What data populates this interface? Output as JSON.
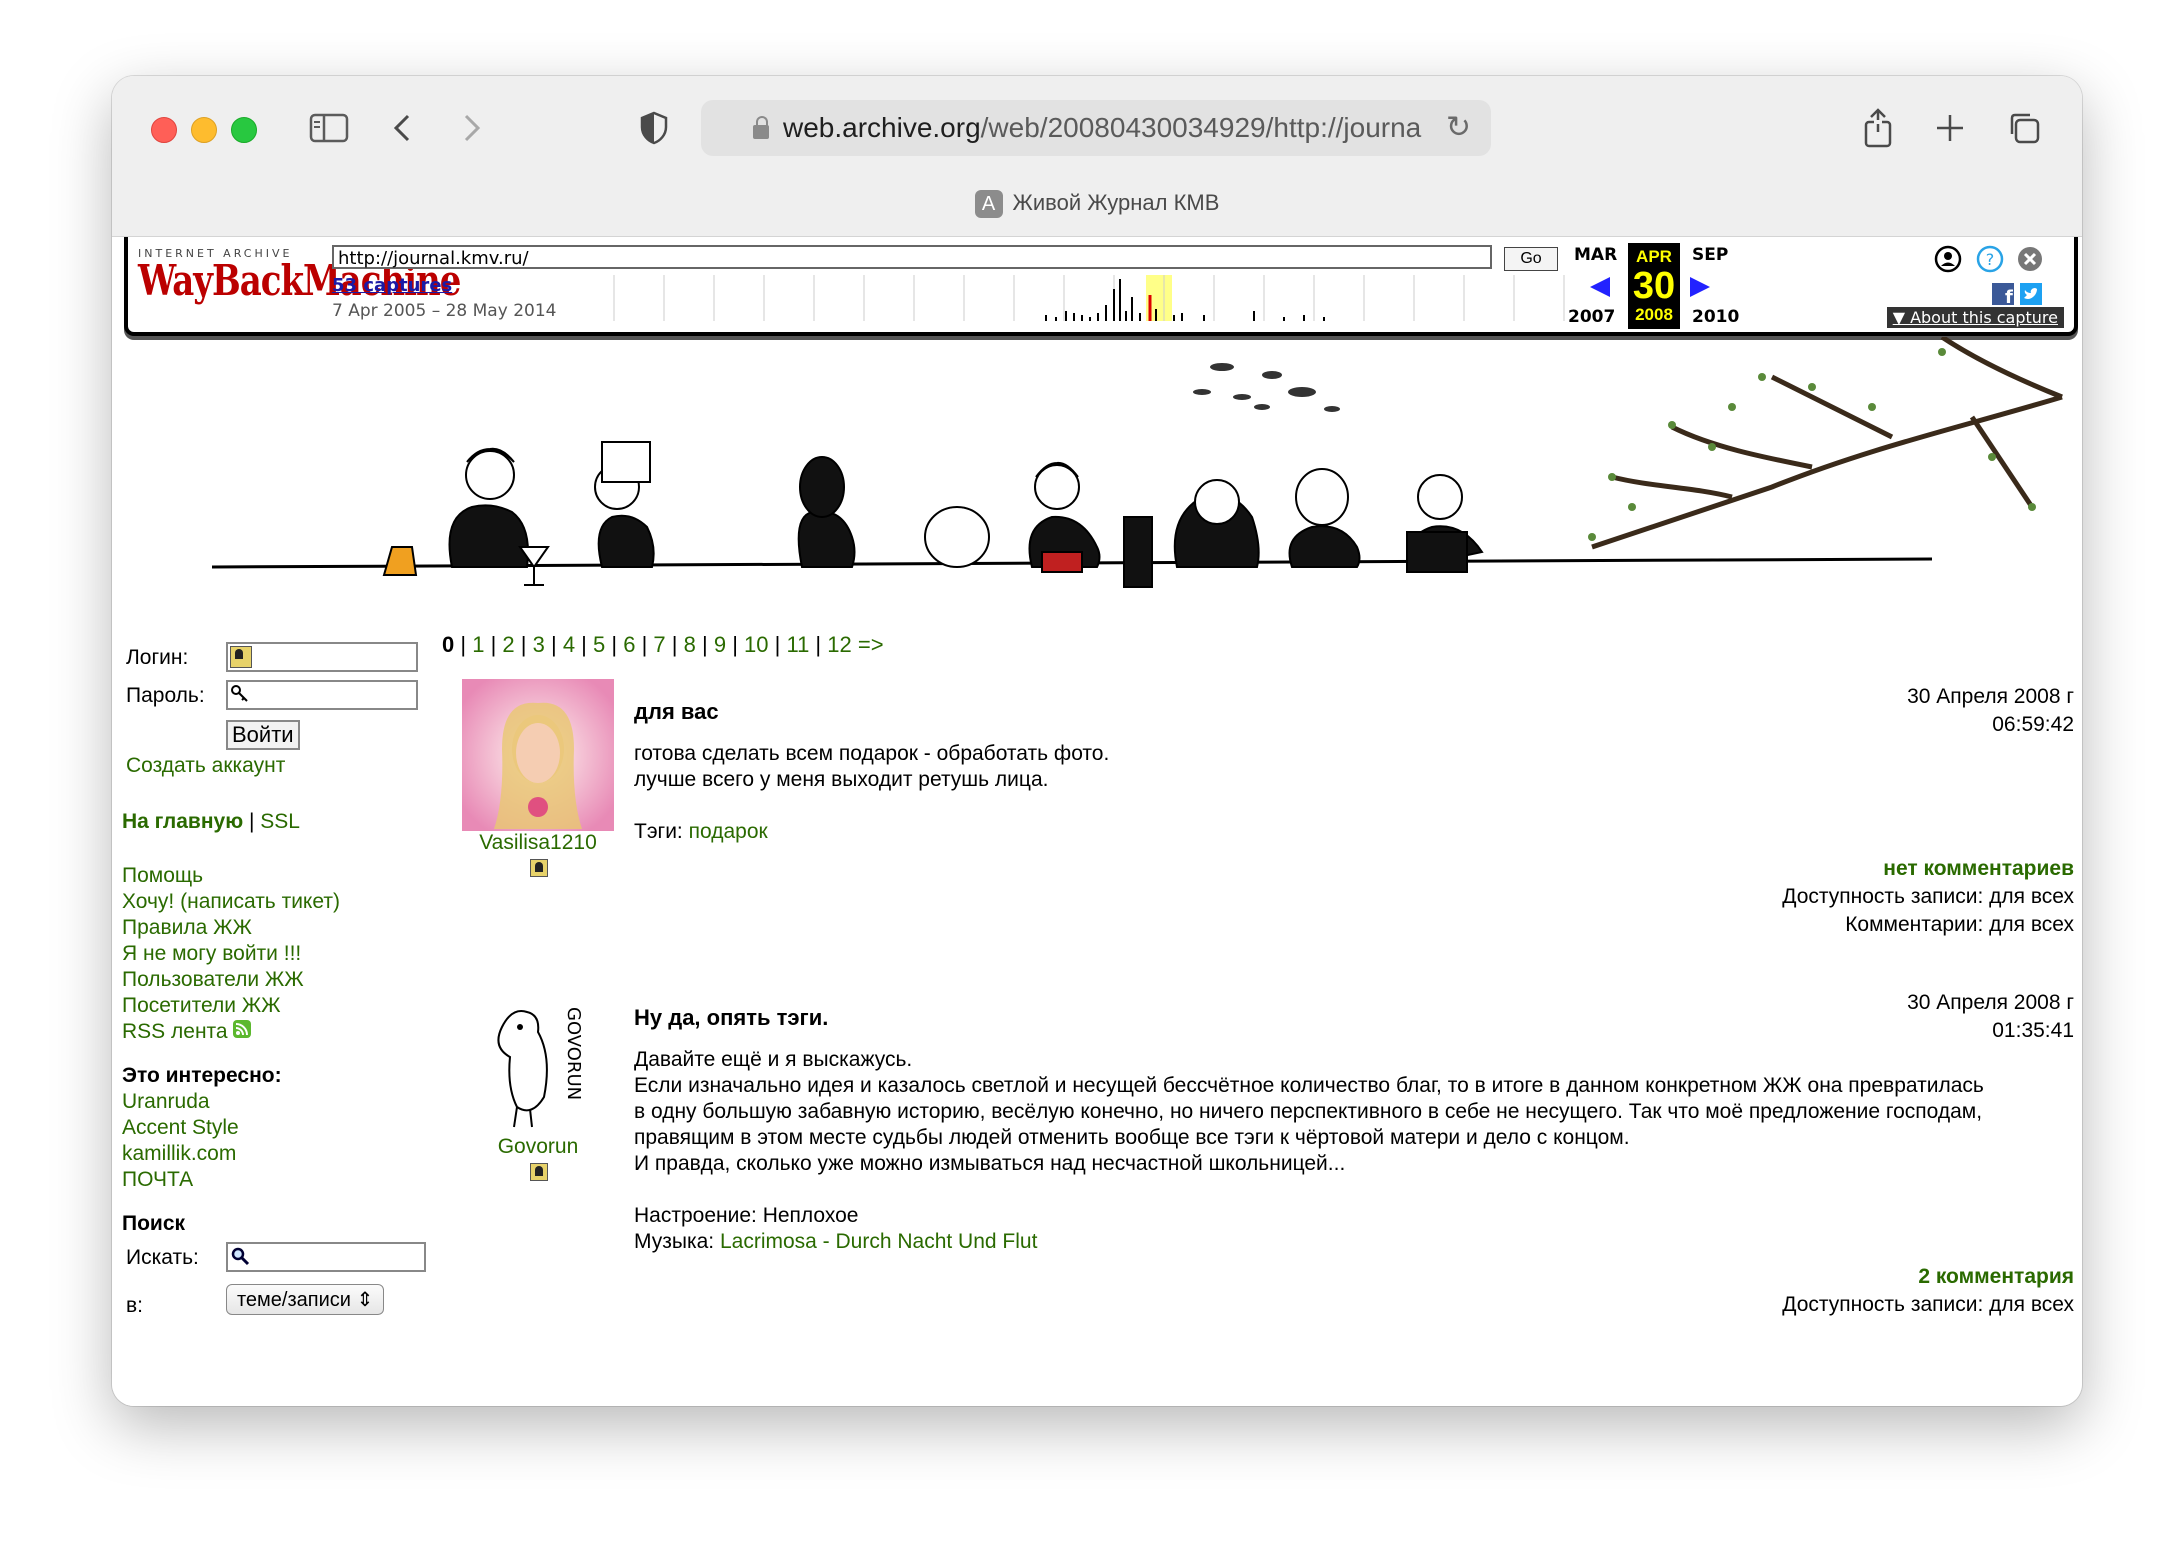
{
  "browser": {
    "url_host": "web.archive.org",
    "url_rest": "/web/20080430034929/http://journa",
    "tab_title": "Живой Журнал КМВ",
    "tab_favicon": "A"
  },
  "wayback": {
    "logo_top": "INTERNET ARCHIVE",
    "logo_main": "WayBackMachine",
    "url_value": "http://journal.kmv.ru/",
    "go_label": "Go",
    "captures": "53 captures",
    "range": "7 Apr 2005 – 28 May 2014",
    "prev_month": "MAR",
    "cur_month": "APR",
    "next_month": "SEP",
    "cur_day": "30",
    "prev_year": "2007",
    "cur_year": "2008",
    "next_year": "2010",
    "about": "▼ About this capture"
  },
  "sidebar": {
    "login_label": "Логин:",
    "password_label": "Пароль:",
    "login_button": "Войти",
    "create_account": "Создать аккаунт",
    "home": "На главную",
    "sep": "|",
    "ssl": "SSL",
    "links": [
      "Помощь",
      "Хочу! (написать тикет)",
      "Правила ЖЖ",
      "Я не могу войти !!!",
      "Пользователи ЖЖ",
      "Посетители ЖЖ",
      "RSS лента"
    ],
    "interesting_title": "Это интересно:",
    "interesting": [
      "Uranruda",
      "Accent Style",
      "kamillik.com",
      "ПОЧТА"
    ],
    "search_title": "Поиск",
    "search_label": "Искать:",
    "in_label": "в:",
    "search_select": "теме/записи"
  },
  "pagination": {
    "current": "0",
    "pages": [
      "1",
      "2",
      "3",
      "4",
      "5",
      "6",
      "7",
      "8",
      "9",
      "10",
      "11",
      "12 =>"
    ]
  },
  "posts": [
    {
      "author": "Vasilisa1210",
      "title": "для вас",
      "date": "30 Апреля 2008 г",
      "time": "06:59:42",
      "lines": [
        "готова сделать всем подарок - обработать фото.",
        "лучше всего у меня выходит ретушь лица."
      ],
      "tags_label": "Тэги:",
      "tag": "подарок",
      "comments": "нет комментариев",
      "access": "Доступность записи: для всех",
      "comments_access": "Комментарии: для всех"
    },
    {
      "author": "Govorun",
      "title": "Ну да, опять тэги.",
      "date": "30 Апреля 2008 г",
      "time": "01:35:41",
      "lines": [
        "Давайте ещё и я выскажусь.",
        "Если изначально идея и казалось светлой и несущей бессчётное количество благ, то в итоге в данном конкретном ЖЖ она превратилась",
        "в одну большую забавную историю, весёлую конечно, но ничего перспективного в себе не несущего. Так что моё предложение господам,",
        "правящим в этом месте судьбы людей отменить вообще все тэги к чёртовой матери и дело с концом.",
        "И правда, сколько уже можно измываться над несчастной школьницей..."
      ],
      "mood_label": "Настроение:",
      "mood": "Неплохое",
      "music_label": "Музыка:",
      "music": "Lacrimosa - Durch Nacht Und Flut",
      "comments": "2 комментария",
      "access": "Доступность записи: для всех"
    }
  ],
  "colors": {
    "link": "#2a6a00",
    "wayback_red": "#b00000",
    "highlight": "#ffff00"
  }
}
